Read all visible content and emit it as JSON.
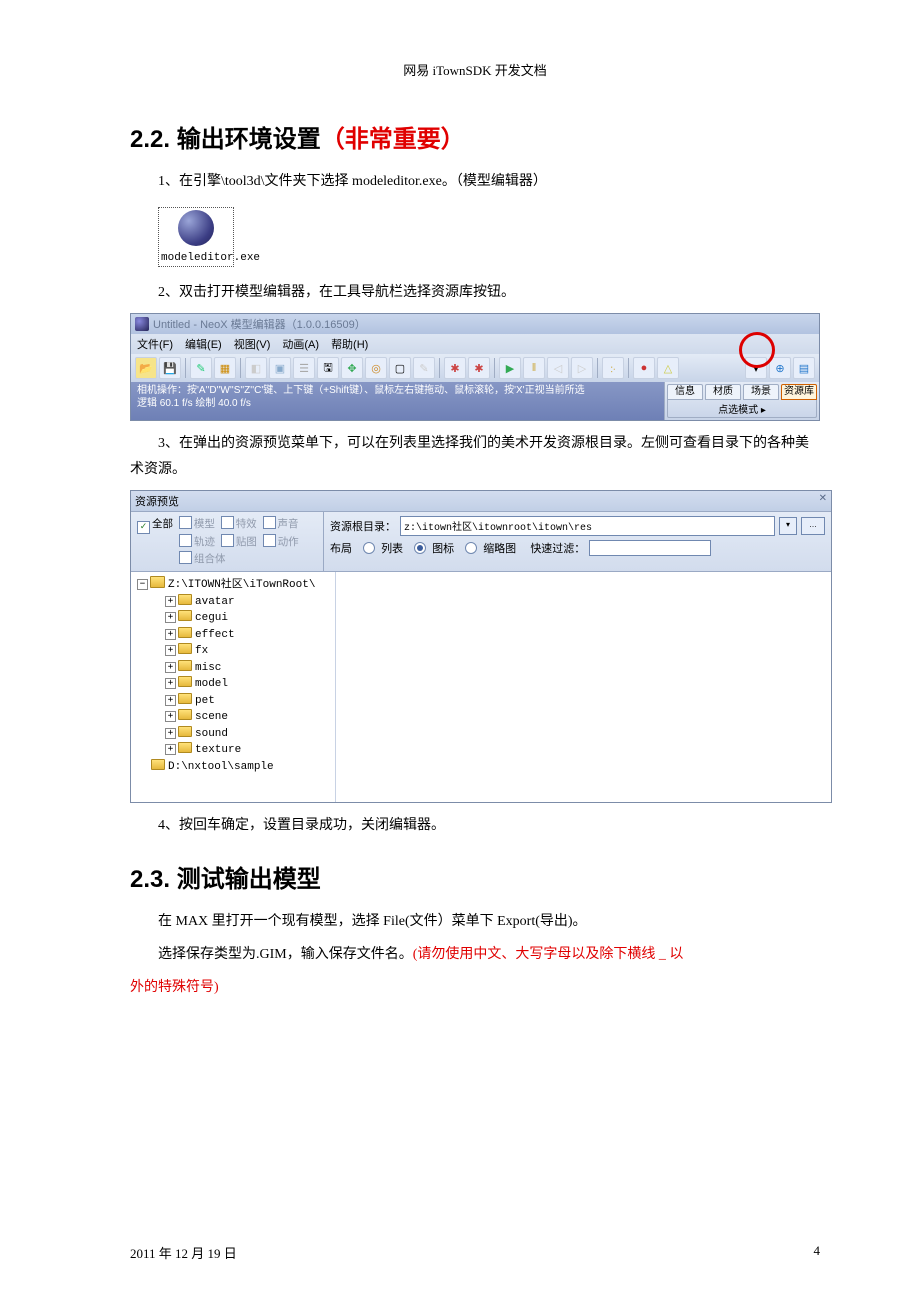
{
  "header": "网易 iTownSDK 开发文档",
  "section22": {
    "number": "2.2.",
    "title": " 输出环境设置",
    "title_highlight": "（非常重要）"
  },
  "step1": "1、在引擎\\tool3d\\文件夹下选择 modeleditor.exe。（模型编辑器）",
  "exe": {
    "caption": "modeleditor.exe"
  },
  "step2": "2、双击打开模型编辑器，在工具导航栏选择资源库按钮。",
  "shot1": {
    "title": "Untitled - NeoX 模型编辑器（1.0.0.16509）",
    "menus": [
      "文件(F)",
      "编辑(E)",
      "视图(V)",
      "动画(A)",
      "帮助(H)"
    ],
    "status_l1": "相机操作：按'A''D''W''S''Z''C'键、上下键（+Shift键）、鼠标左右键拖动、鼠标滚轮，按'X'正视当前所选",
    "status_l2": "逻辑 60.1 f/s  绘制 40.0 f/s",
    "right_tabs": [
      "信息",
      "材质",
      "场景",
      "资源库"
    ],
    "right_mode": "点选模式"
  },
  "step3": "3、在弹出的资源预览菜单下，可以在列表里选择我们的美术开发资源根目录。左侧可查看目录下的各种美术资源。",
  "shot2": {
    "title": "资源预览",
    "filters": {
      "all": "全部",
      "model": "模型",
      "effect": "特效",
      "sound": "声音",
      "track": "轨迹",
      "texture": "贴图",
      "action": "动作",
      "combo": "组合体"
    },
    "root_label": "资源根目录：",
    "root_path": "z:\\itown社区\\itownroot\\itown\\res",
    "layout_label": "布局",
    "layout_list": "列表",
    "layout_icon": "图标",
    "layout_thumb": "缩略图",
    "quick_filter": "快速过滤：",
    "tree": {
      "root": "Z:\\ITOWN社区\\iTownRoot\\",
      "children": [
        "avatar",
        "cegui",
        "effect",
        "fx",
        "misc",
        "model",
        "pet",
        "scene",
        "sound",
        "texture"
      ],
      "sibling": "D:\\nxtool\\sample"
    }
  },
  "step4": "4、按回车确定，设置目录成功，关闭编辑器。",
  "section23": {
    "number": "2.3.",
    "title": " 测试输出模型"
  },
  "para23a": "在 MAX 里打开一个现有模型，选择 File(文件）菜单下 Export(导出)。",
  "para23b_plain": "选择保存类型为.GIM，输入保存文件名。",
  "para23b_red": "(请勿使用中文、大写字母以及除下横线 _ 以",
  "para23b_red2": "外的特殊符号)",
  "footer": {
    "date": "2011 年 12 月 19 日",
    "page": "4"
  }
}
